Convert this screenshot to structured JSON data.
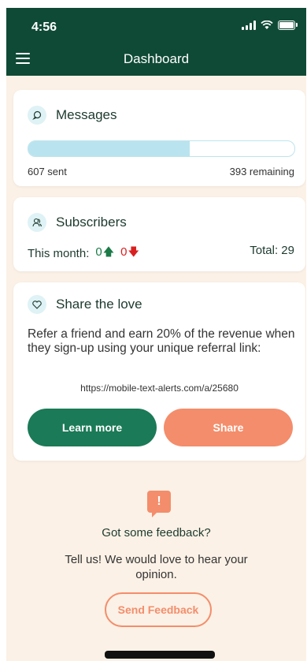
{
  "status_bar": {
    "time": "4:56"
  },
  "header": {
    "title": "Dashboard",
    "menu_icon": "hamburger-menu-icon"
  },
  "messages": {
    "title": "Messages",
    "icon": "message-bubble-icon",
    "sent_label": "607 sent",
    "remaining_label": "393 remaining",
    "progress_fraction": 0.607,
    "progress_color": "#b9e4ef"
  },
  "subscribers": {
    "title": "Subscribers",
    "icon": "users-icon",
    "month_label": "This month:",
    "up_value": "0",
    "down_value": "0",
    "total_label": "Total: 29",
    "up_color": "#1b7a47",
    "down_color": "#d92020"
  },
  "share": {
    "title": "Share the love",
    "icon": "heart-icon",
    "description": "Refer a friend and earn 20% of the revenue when they sign-up using your unique referral link:",
    "link": "https://mobile-text-alerts.com/a/25680",
    "learn_more_label": "Learn more",
    "share_label": "Share"
  },
  "feedback": {
    "icon": "feedback-alert-icon",
    "title": "Got some feedback?",
    "text": "Tell us! We would love to hear your opinion.",
    "button_label": "Send Feedback"
  },
  "colors": {
    "header_bg": "#0f4a36",
    "page_bg": "#fbf1e6",
    "primary_green": "#1b7a57",
    "accent_orange": "#f48d6b"
  }
}
